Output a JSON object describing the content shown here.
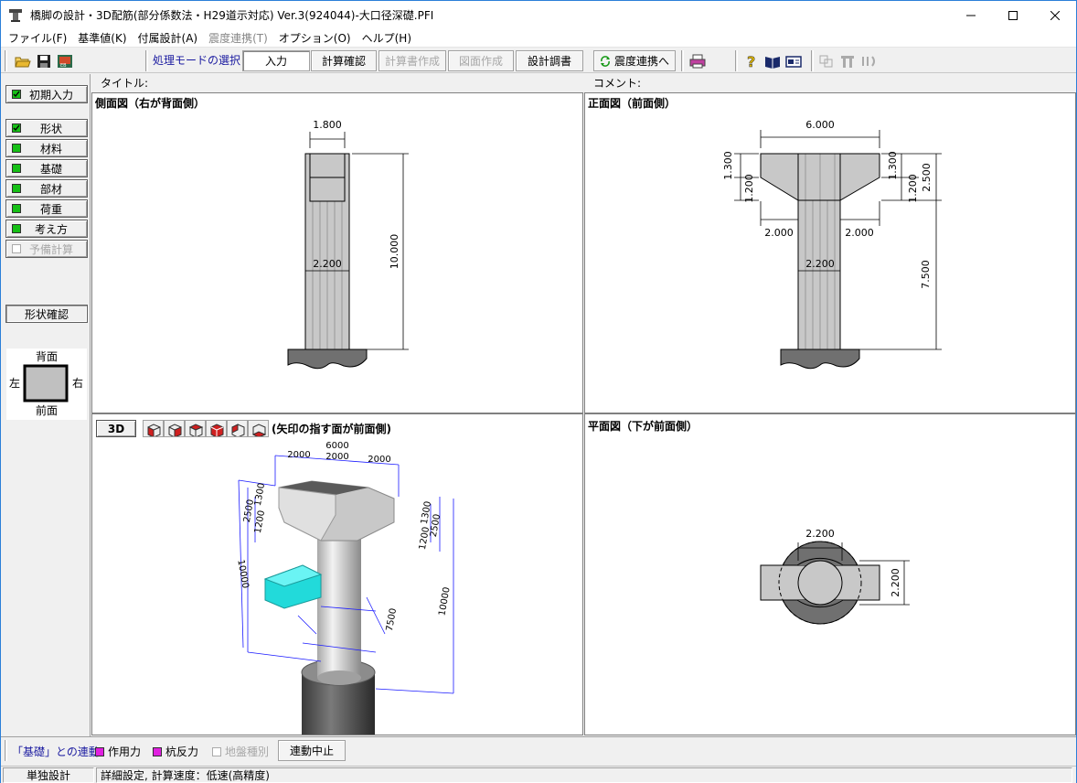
{
  "window": {
    "title": "橋脚の設計・3D配筋(部分係数法・H29道示対応) Ver.3(924044)-大口径深礎.PFI"
  },
  "menu": [
    {
      "label": "ファイル(F)",
      "enabled": true
    },
    {
      "label": "基準値(K)",
      "enabled": true
    },
    {
      "label": "付属設計(A)",
      "enabled": true
    },
    {
      "label": "震度連携(T)",
      "enabled": false
    },
    {
      "label": "オプション(O)",
      "enabled": true
    },
    {
      "label": "ヘルプ(H)",
      "enabled": true
    }
  ],
  "toolbar": {
    "mode_label": "処理モードの選択",
    "input": "入力",
    "calc_check": "計算確認",
    "report_create": "計算書作成",
    "drawing_create": "図面作成",
    "design_doc": "設計調書",
    "seismic_link": "震度連携へ",
    "icons": [
      "open-icon",
      "save-icon",
      "image-icon",
      "print-icon",
      "help-icon",
      "book-icon",
      "card-icon",
      "link-icon",
      "tree-icon",
      "anchor-icon"
    ]
  },
  "left_panel": {
    "initial_input": "初期入力",
    "items": [
      {
        "label": "形状",
        "state": "checked"
      },
      {
        "label": "材料",
        "state": "on"
      },
      {
        "label": "基礎",
        "state": "on"
      },
      {
        "label": "部材",
        "state": "on"
      },
      {
        "label": "荷重",
        "state": "on"
      },
      {
        "label": "考え方",
        "state": "on"
      },
      {
        "label": "予備計算",
        "state": "disabled"
      }
    ],
    "shape_check": "形状確認",
    "orientation": {
      "top": "背面",
      "bottom": "前面",
      "left": "左",
      "right": "右"
    }
  },
  "headers": {
    "title_label": "タイトル:",
    "comment_label": "コメント:"
  },
  "views": {
    "side": {
      "title": "側面図（右が背面側）",
      "dims": {
        "top_width": "1.800",
        "col_width": "2.200",
        "height": "10.000"
      }
    },
    "front": {
      "title": "正面図（前面側）",
      "dims": {
        "top_width": "6.000",
        "h1": "1.300",
        "h2": "1.200",
        "h_total": "2.500",
        "left_overhang": "2.000",
        "right_overhang": "2.000",
        "col_width": "2.200",
        "col_height": "7.500"
      }
    },
    "three_d": {
      "button": "3D",
      "note": "(矢印の指す面が前面側)",
      "labels": {
        "top_total": "6000",
        "top_left": "2000",
        "top_mid": "2000",
        "top_right": "2000",
        "left_a": "2500",
        "left_b": "1300",
        "left_c": "1200",
        "height_left": "10000",
        "right_a": "1300",
        "right_b": "1200",
        "right_c": "2500",
        "height_right": "10000",
        "mid": "7500"
      }
    },
    "plan": {
      "title": "平面図（下が前面側）",
      "dims": {
        "width": "2.200",
        "depth": "2.200"
      }
    }
  },
  "bottom": {
    "link_label": "「基礎」との連動",
    "options": [
      {
        "label": "作用力",
        "state": "magenta"
      },
      {
        "label": "杭反力",
        "state": "magenta"
      },
      {
        "label": "地盤種別",
        "state": "disabled"
      }
    ],
    "stop_button": "連動中止"
  },
  "status": {
    "mode": "単独設計",
    "detail": "詳細設定, 計算速度：低速(高精度)"
  }
}
